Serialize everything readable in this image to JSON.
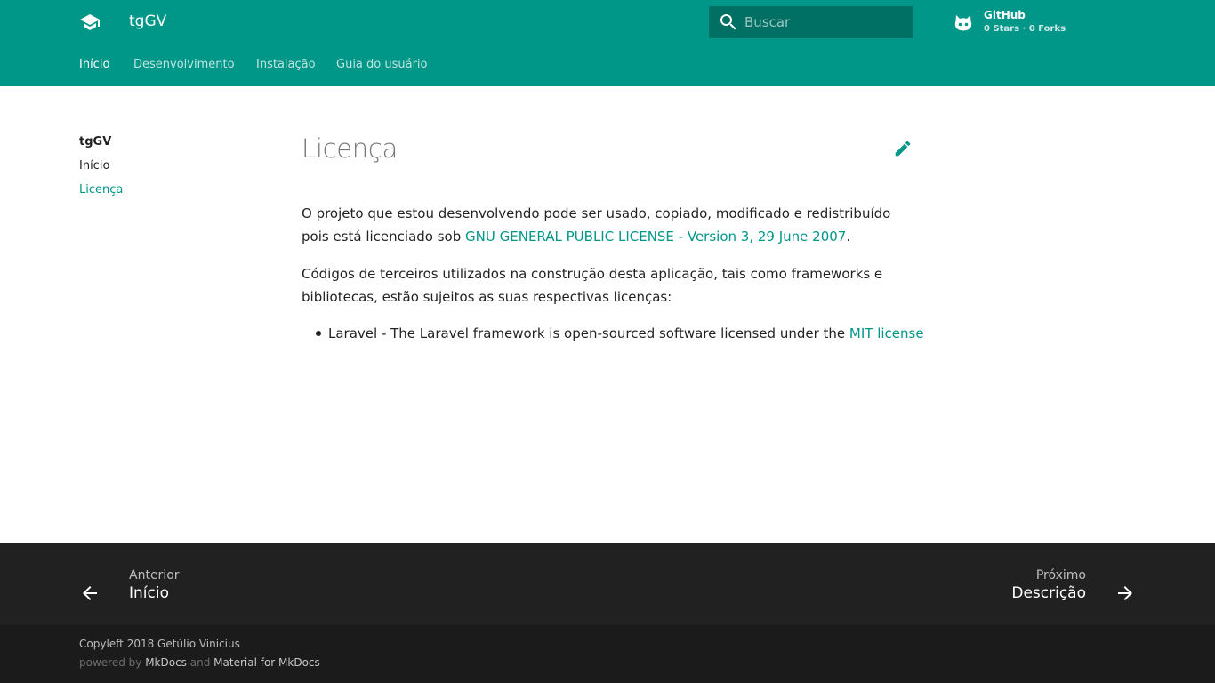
{
  "header": {
    "site_title": "tgGV",
    "search_placeholder": "Buscar",
    "repo": {
      "name": "GitHub",
      "facts": "0 Stars · 0 Forks"
    }
  },
  "tabs": [
    {
      "label": "Início",
      "active": true
    },
    {
      "label": "Desenvolvimento",
      "active": false
    },
    {
      "label": "Instalação",
      "active": false
    },
    {
      "label": "Guia do usuário",
      "active": false
    }
  ],
  "sidebar": {
    "title": "tgGV",
    "items": [
      {
        "label": "Início",
        "active": false
      },
      {
        "label": "Licença",
        "active": true
      }
    ]
  },
  "content": {
    "title": "Licença",
    "p1_text": "O projeto que estou desenvolvendo pode ser usado, copiado, modificado e redistribuído pois está licenciado sob",
    "p1_link": "GNU GENERAL PUBLIC LICENSE - Version 3, 29 June 2007",
    "p1_end": ".",
    "p2_text": "Códigos de terceiros utilizados na construção desta aplicação, tais como frameworks e bibliotecas, estão sujeitos as suas respectivas licenças:",
    "list": [
      {
        "text": "Laravel - The Laravel framework is open-sourced software licensed under the",
        "link": "MIT license"
      }
    ]
  },
  "footer": {
    "prev": {
      "direction": "Anterior",
      "title": "Início"
    },
    "next": {
      "direction": "Próximo",
      "title": "Descrição"
    },
    "copyright": "Copyleft 2018 Getúlio Vinicius",
    "powered_prefix": "powered by",
    "powered_mkdocs": "MkDocs",
    "powered_and": "and",
    "powered_material": "Material for MkDocs"
  },
  "colors": {
    "primary": "#009688",
    "footer_nav": "#212121",
    "footer_meta": "#1a1a1a"
  },
  "icons": {
    "logo": "school-icon",
    "search": "search-icon",
    "repo": "github-icon",
    "edit": "pencil-icon",
    "prev": "arrow-back-icon",
    "next": "arrow-forward-icon"
  }
}
